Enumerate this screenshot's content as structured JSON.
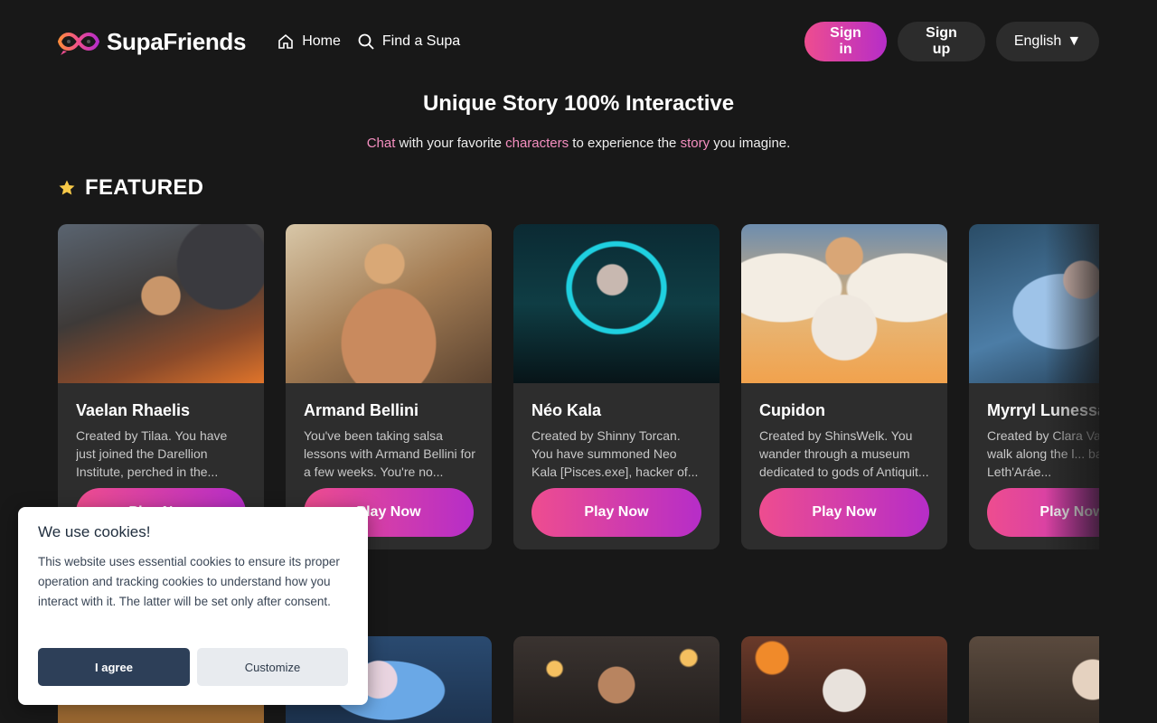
{
  "header": {
    "logo_text": "SupaFriends",
    "nav": [
      {
        "label": "Home",
        "icon": "home-icon"
      },
      {
        "label": "Find a Supa",
        "icon": "search-icon"
      }
    ],
    "signin_label": "Sign in",
    "signup_label": "Sign up",
    "language_label": "English",
    "language_caret": "▼"
  },
  "hero": {
    "title": "Unique Story 100% Interactive",
    "sub": {
      "w1": "Chat",
      "t1": " with your favorite ",
      "w2": "characters",
      "t2": " to experience the ",
      "w3": "story",
      "t3": " you imagine."
    }
  },
  "featured": {
    "title": "FEATURED",
    "cards": [
      {
        "name": "Vaelan Rhaelis",
        "desc": "Created by Tilaa. You have just joined the Darellion Institute, perched in the...",
        "button": "Play Now"
      },
      {
        "name": "Armand Bellini",
        "desc": "You've been taking salsa lessons with Armand Bellini for a few weeks. You're no...",
        "button": "Play Now"
      },
      {
        "name": "Néo Kala",
        "desc": "Created by Shinny Torcan. You have summoned Neo Kala [Pisces.exe], hacker of...",
        "button": "Play Now"
      },
      {
        "name": "Cupidon",
        "desc": "Created by ShinsWelk. You wander through a museum dedicated to gods of Antiquit...",
        "button": "Play Now"
      },
      {
        "name": "Myrryl Lunessa",
        "desc": "Created by Clara Va... you walk along the l... basins of Leth'Aráe...",
        "button": "Play Now"
      }
    ]
  },
  "cookie": {
    "title": "We use cookies!",
    "text": "This website uses essential cookies to ensure its proper operation and tracking cookies to understand how you interact with it. The latter will be set only after consent.",
    "agree_label": "I agree",
    "customize_label": "Customize"
  },
  "colors": {
    "accent_pink": "#ee4d8f",
    "accent_purple": "#b62dc8",
    "background": "#181818",
    "card_bg": "#2d2d2d"
  }
}
